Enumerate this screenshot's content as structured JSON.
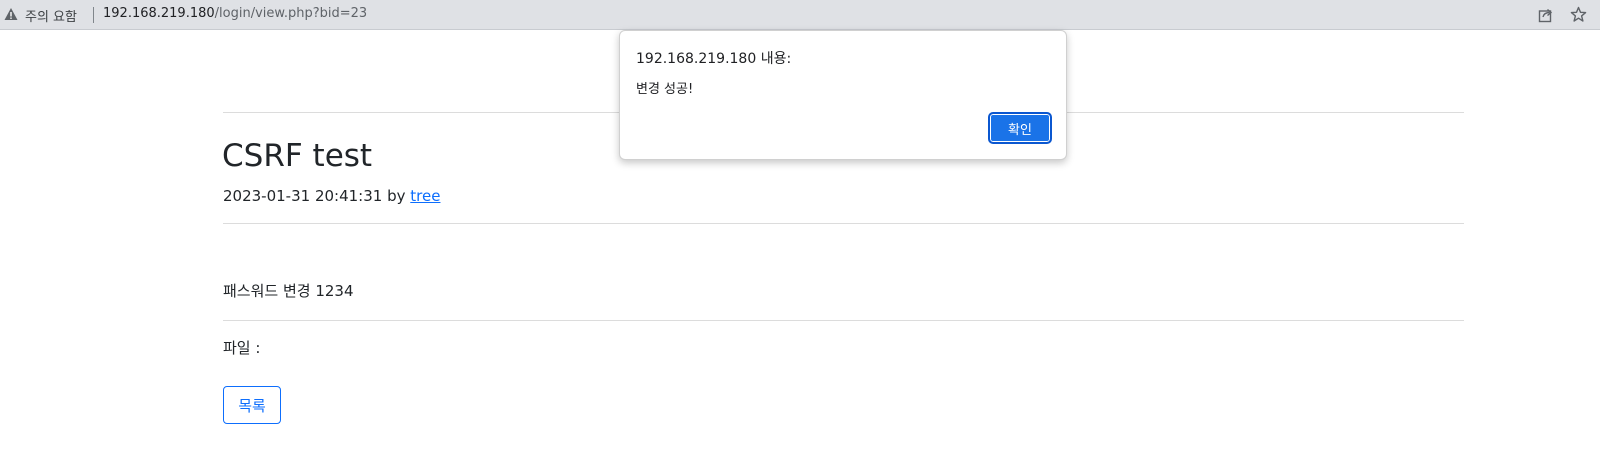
{
  "browser": {
    "security_label": "주의 요함",
    "url_host": "192.168.219.180",
    "url_path": "/login/view.php?bid=23"
  },
  "post": {
    "title": "CSRF test",
    "datetime": "2023-01-31 20:41:31",
    "by": "by",
    "author": "tree",
    "content": "패스워드 변경 1234",
    "file_label": "파일 :",
    "list_button": "목록"
  },
  "alert": {
    "title": "192.168.219.180 내용:",
    "message": "변경 성공!",
    "ok_label": "확인"
  },
  "colors": {
    "accent": "#0d6efd",
    "dialog_button": "#1a73e8",
    "addressbar": "#dfe1e5"
  }
}
